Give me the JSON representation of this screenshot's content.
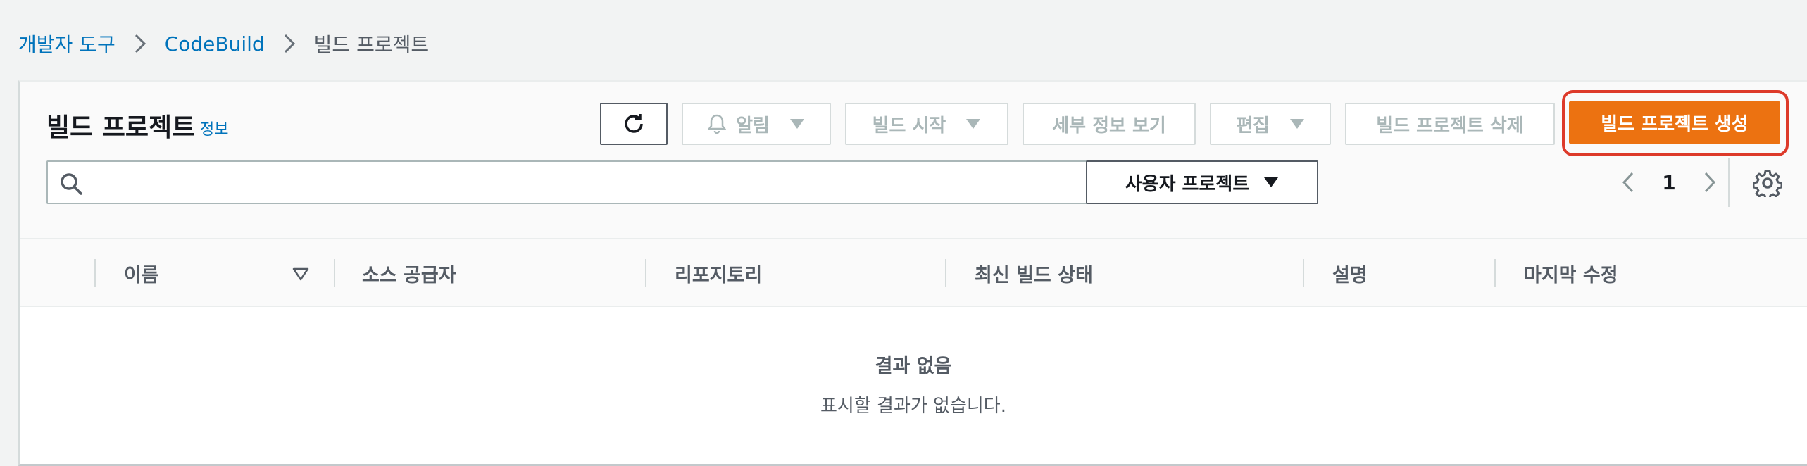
{
  "breadcrumb": {
    "items": [
      "개발자 도구",
      "CodeBuild",
      "빌드 프로젝트"
    ]
  },
  "panel": {
    "title": "빌드 프로젝트",
    "info_link": "정보"
  },
  "toolbar": {
    "refresh_icon": "refresh-icon",
    "notify_label": "알림",
    "start_build_label": "빌드 시작",
    "view_details_label": "세부 정보 보기",
    "edit_label": "편집",
    "delete_label": "빌드 프로젝트 삭제",
    "create_label": "빌드 프로젝트 생성"
  },
  "search": {
    "value": "",
    "placeholder": ""
  },
  "filter": {
    "selected": "사용자 프로젝트"
  },
  "pagination": {
    "current_page": "1"
  },
  "table": {
    "columns": [
      "이름",
      "소스 공급자",
      "리포지토리",
      "최신 빌드 상태",
      "설명",
      "마지막 수정"
    ],
    "rows": []
  },
  "empty_state": {
    "title": "결과 없음",
    "description": "표시할 결과가 없습니다."
  },
  "colors": {
    "primary": "#ec7211",
    "link": "#0073bb",
    "highlight": "#dd3a2a"
  }
}
